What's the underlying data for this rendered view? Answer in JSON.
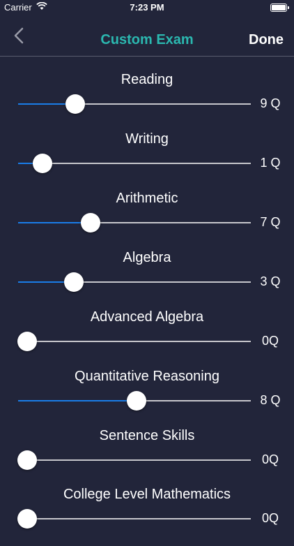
{
  "status": {
    "carrier": "Carrier",
    "time": "7:23 PM"
  },
  "nav": {
    "title": "Custom Exam",
    "done": "Done"
  },
  "subjects": [
    {
      "label": "Reading",
      "count": "9 Q",
      "level": 0.245
    },
    {
      "label": "Writing",
      "count": "1 Q",
      "level": 0.105
    },
    {
      "label": "Arithmetic",
      "count": "7 Q",
      "level": 0.31
    },
    {
      "label": "Algebra",
      "count": "3 Q",
      "level": 0.24
    },
    {
      "label": "Advanced Algebra",
      "count": "0Q",
      "level": 0.04
    },
    {
      "label": "Quantitative Reasoning",
      "count": "8 Q",
      "level": 0.51
    },
    {
      "label": "Sentence Skills",
      "count": "0Q",
      "level": 0.04
    },
    {
      "label": "College Level Mathematics",
      "count": "0Q",
      "level": 0.04
    }
  ]
}
